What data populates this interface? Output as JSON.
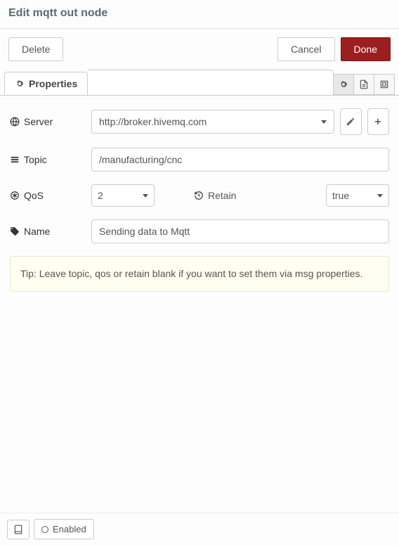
{
  "header": {
    "title": "Edit mqtt out node"
  },
  "buttons": {
    "delete": "Delete",
    "cancel": "Cancel",
    "done": "Done"
  },
  "tabs": {
    "properties": "Properties"
  },
  "fields": {
    "server": {
      "label": "Server",
      "value": "http://broker.hivemq.com"
    },
    "topic": {
      "label": "Topic",
      "value": "/manufacturing/cnc"
    },
    "qos": {
      "label": "QoS",
      "value": "2"
    },
    "retain": {
      "label": "Retain",
      "value": "true"
    },
    "name": {
      "label": "Name",
      "value": "Sending data to Mqtt"
    }
  },
  "tip": "Tip: Leave topic, qos or retain blank if you want to set them via msg properties.",
  "footer": {
    "enabled": "Enabled"
  }
}
